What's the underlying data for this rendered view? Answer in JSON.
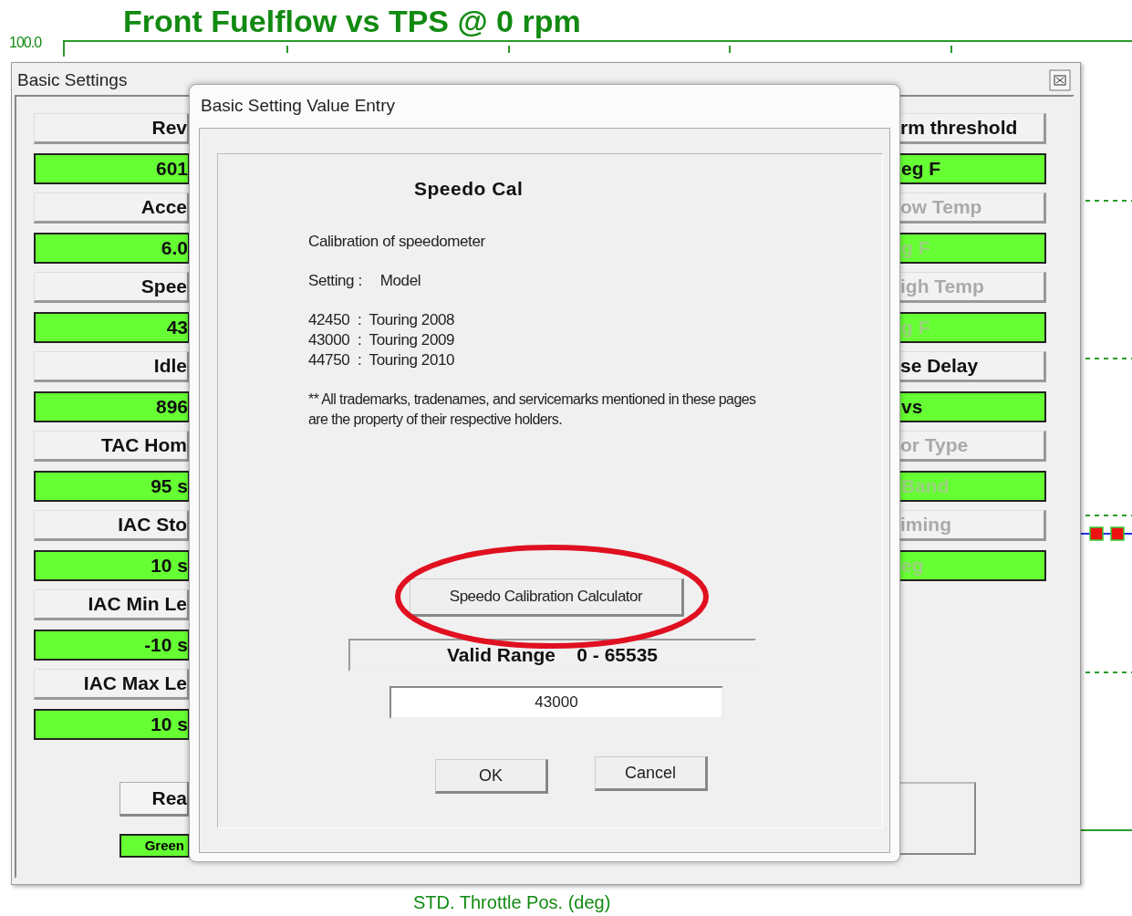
{
  "chart": {
    "title": "Front Fuelflow vs TPS @ 0 rpm",
    "y_max_label": "100.0",
    "x_axis_label": "STD. Throttle Pos. (deg)"
  },
  "basic_settings": {
    "title": "Basic Settings",
    "left_rows": [
      {
        "kind": "label",
        "text": "Rev",
        "disabled": false
      },
      {
        "kind": "value",
        "text": "601",
        "disabled": false
      },
      {
        "kind": "label",
        "text": "Acce",
        "disabled": false
      },
      {
        "kind": "value",
        "text": "6.0",
        "disabled": false
      },
      {
        "kind": "label",
        "text": "Spee",
        "disabled": false
      },
      {
        "kind": "value",
        "text": "43",
        "disabled": false
      },
      {
        "kind": "label",
        "text": "Idle",
        "disabled": false
      },
      {
        "kind": "value",
        "text": "896",
        "disabled": false
      },
      {
        "kind": "label",
        "text": "TAC Hom",
        "disabled": false
      },
      {
        "kind": "value",
        "text": "95 s",
        "disabled": false
      },
      {
        "kind": "label",
        "text": "IAC Sto",
        "disabled": false
      },
      {
        "kind": "value",
        "text": "10 s",
        "disabled": false
      },
      {
        "kind": "label",
        "text": "IAC Min Le",
        "disabled": false
      },
      {
        "kind": "value",
        "text": "-10 s",
        "disabled": false
      },
      {
        "kind": "label",
        "text": "IAC Max Le",
        "disabled": false
      },
      {
        "kind": "value",
        "text": "10 s",
        "disabled": false
      }
    ],
    "right_rows": [
      {
        "kind": "label",
        "text": "rm threshold",
        "disabled": false
      },
      {
        "kind": "value",
        "text": "eg F",
        "disabled": false
      },
      {
        "kind": "label",
        "text": "ow Temp",
        "disabled": true
      },
      {
        "kind": "value",
        "text": "g F",
        "disabled": true
      },
      {
        "kind": "label",
        "text": "igh Temp",
        "disabled": true
      },
      {
        "kind": "value",
        "text": "g F",
        "disabled": true
      },
      {
        "kind": "label",
        "text": "se Delay",
        "disabled": false
      },
      {
        "kind": "value",
        "text": "vs",
        "disabled": false
      },
      {
        "kind": "label",
        "text": "or Type",
        "disabled": true
      },
      {
        "kind": "value",
        "text": "Band",
        "disabled": true
      },
      {
        "kind": "label",
        "text": "iming",
        "disabled": true
      },
      {
        "kind": "value",
        "text": "eg",
        "disabled": true
      }
    ],
    "read_button": "Rea",
    "status_badge": "Green"
  },
  "dialog": {
    "title": "Basic Setting Value Entry",
    "heading": "Speedo Cal",
    "description": "Calibration of speedometer",
    "setting_label": "Setting :",
    "setting_value": "Model",
    "options": [
      "42450  :  Touring 2008",
      "43000  :  Touring 2009",
      "44750  :  Touring 2010"
    ],
    "note": "** All trademarks, tradenames, and servicemarks mentioned in these pages are the property of their respective holders.",
    "calculator_button": "Speedo Calibration Calculator",
    "valid_range": "Valid Range    0 - 65535",
    "value": "43000",
    "ok_button": "OK",
    "cancel_button": "Cancel"
  }
}
